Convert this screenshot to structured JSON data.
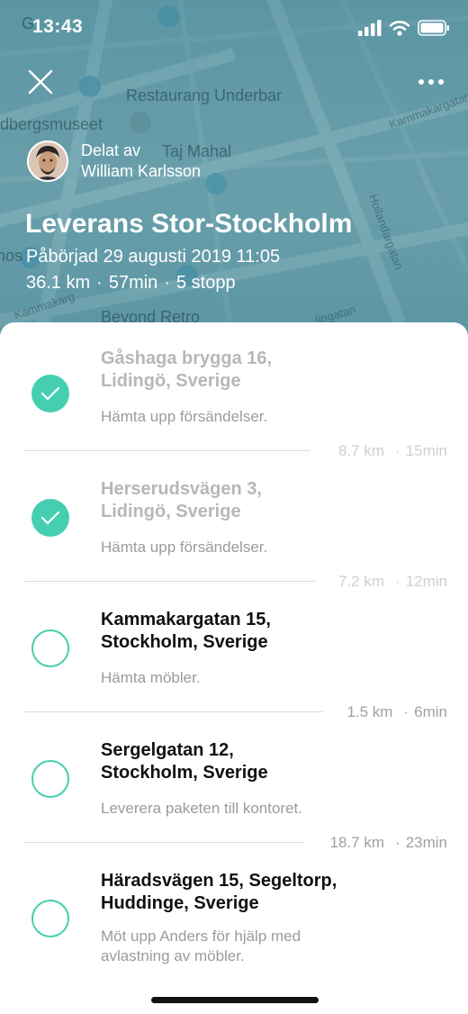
{
  "status_bar": {
    "time": "13:43"
  },
  "map": {
    "labels": {
      "restaurant": "Restaurang Underbar",
      "museum": "dbergsmuseet",
      "taj": "Taj Mahal",
      "kammakargatan": "Kammakargatan",
      "hollandargatan": "Hollandargatan",
      "beyond": "Beyond Retro",
      "kammakarg_left": "Kammakarg",
      "top_left": "G",
      "left_edge": "hos",
      "bottom_right": "lingatan"
    }
  },
  "header": {
    "shared_by_label": "Delat av",
    "shared_by_name": "William Karlsson",
    "title": "Leverans Stor-Stockholm",
    "started": "Påbörjad 29 augusti 2019 11:05",
    "distance": "36.1 km",
    "duration": "57min",
    "stops": "5 stopp",
    "separator": "·"
  },
  "stops": [
    {
      "line1": "Gåshaga brygga 16,",
      "line2": "Lidingö, Sverige",
      "note": "Hämta upp försändelser.",
      "completed": true
    },
    {
      "line1": "Herserudsvägen 3,",
      "line2": "Lidingö, Sverige",
      "note": "Hämta upp försändelser.",
      "completed": true
    },
    {
      "line1": "Kammakargatan 15,",
      "line2": "Stockholm, Sverige",
      "note": "Hämta möbler.",
      "completed": false
    },
    {
      "line1": "Sergelgatan 12,",
      "line2": "Stockholm, Sverige",
      "note": "Leverera paketen till kontoret.",
      "completed": false
    },
    {
      "line1": "Häradsvägen 15, Segeltorp,",
      "line2": "Huddinge, Sverige",
      "note": "Möt upp Anders för hjälp med",
      "note2": "avlastning av möbler.",
      "completed": false
    }
  ],
  "legs": [
    {
      "distance": "8.7 km",
      "time": "15min",
      "sep": "·"
    },
    {
      "distance": "7.2 km",
      "time": "12min",
      "sep": "·"
    },
    {
      "distance": "1.5 km",
      "time": "6min",
      "sep": "·"
    },
    {
      "distance": "18.7 km",
      "time": "23min",
      "sep": "·"
    }
  ],
  "colors": {
    "accent": "#45cfb0",
    "map": "#5f9aa6"
  }
}
